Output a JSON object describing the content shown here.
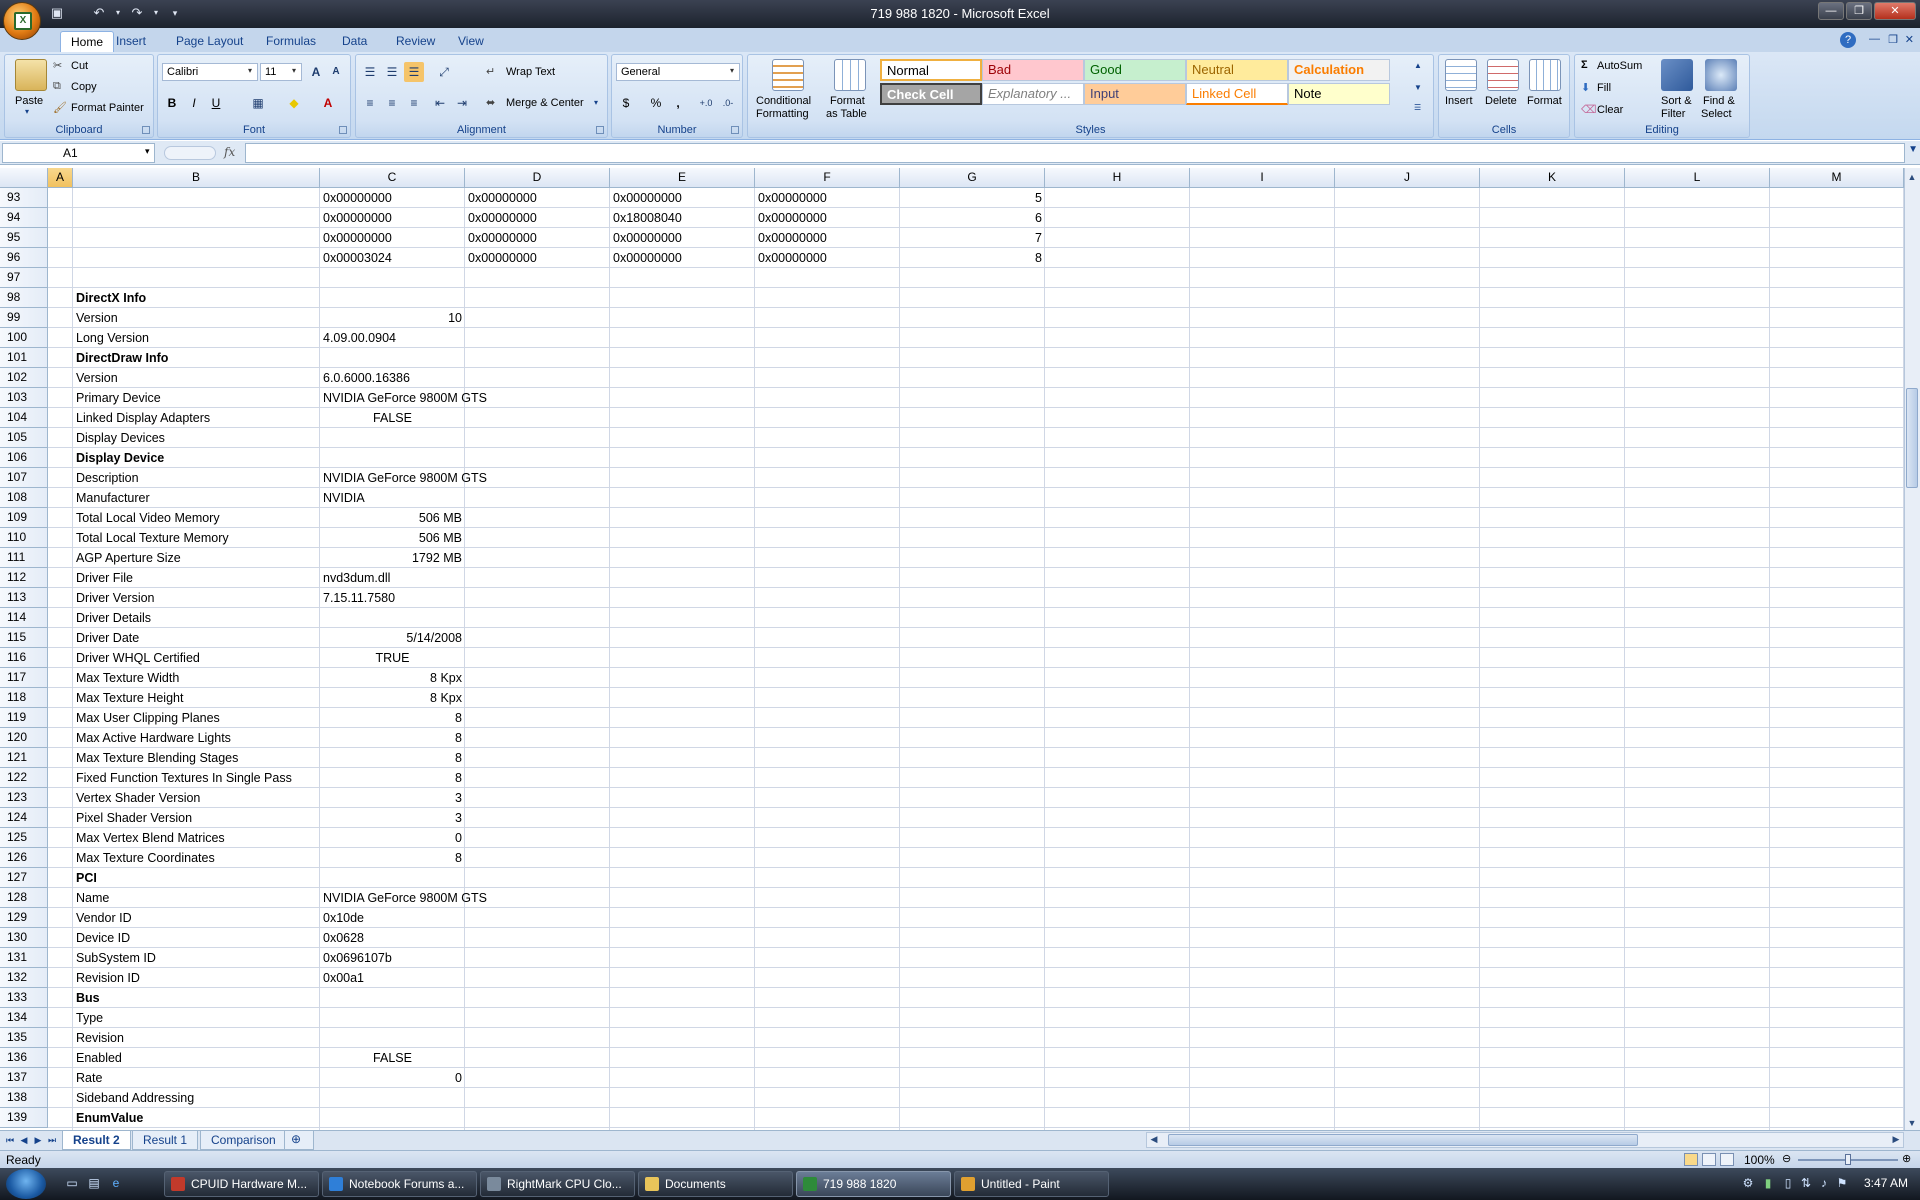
{
  "window": {
    "title": "719 988 1820 - Microsoft Excel"
  },
  "ribbon": {
    "tabs": [
      "Home",
      "Insert",
      "Page Layout",
      "Formulas",
      "Data",
      "Review",
      "View"
    ],
    "clipboard": {
      "paste": "Paste",
      "cut": "Cut",
      "copy": "Copy",
      "format_painter": "Format Painter",
      "label": "Clipboard"
    },
    "font": {
      "name": "Calibri",
      "size": "11",
      "label": "Font",
      "bold": "B",
      "italic": "I",
      "underline": "U"
    },
    "alignment": {
      "wrap_text": "Wrap Text",
      "merge_center": "Merge & Center",
      "label": "Alignment"
    },
    "number": {
      "format": "General",
      "currency": "$",
      "percent": "%",
      "comma": ",",
      "label": "Number"
    },
    "styles": {
      "conditional": "Conditional",
      "conditional2": "Formatting",
      "format_table": "Format",
      "format_table2": "as Table",
      "label": "Styles",
      "cells": [
        {
          "name": "Normal",
          "bg": "#ffffff",
          "fg": "#000000"
        },
        {
          "name": "Bad",
          "bg": "#ffc7ce",
          "fg": "#9c0006"
        },
        {
          "name": "Good",
          "bg": "#c6efce",
          "fg": "#006100"
        },
        {
          "name": "Neutral",
          "bg": "#ffeb9c",
          "fg": "#9c6500"
        },
        {
          "name": "Calculation",
          "bg": "#f2f2f2",
          "fg": "#fa7d00"
        },
        {
          "name": "Check Cell",
          "bg": "#a5a5a5",
          "fg": "#ffffff"
        },
        {
          "name": "Explanatory ...",
          "bg": "#ffffff",
          "fg": "#7f7f7f"
        },
        {
          "name": "Input",
          "bg": "#ffcc99",
          "fg": "#3f3f76"
        },
        {
          "name": "Linked Cell",
          "bg": "#ffffff",
          "fg": "#fa7d00"
        },
        {
          "name": "Note",
          "bg": "#ffffcc",
          "fg": "#000000"
        }
      ]
    },
    "cells": {
      "insert": "Insert",
      "delete": "Delete",
      "format": "Format",
      "label": "Cells"
    },
    "editing": {
      "autosum": "AutoSum",
      "fill": "Fill",
      "clear": "Clear",
      "sort": "Sort &",
      "sort2": "Filter",
      "find": "Find &",
      "find2": "Select",
      "label": "Editing"
    }
  },
  "formula_bar": {
    "name_box": "A1",
    "fx": "fx",
    "value": ""
  },
  "columns": [
    "A",
    "B",
    "C",
    "D",
    "E",
    "F",
    "G",
    "H",
    "I",
    "J",
    "K",
    "L",
    "M"
  ],
  "rows": [
    {
      "n": "93",
      "C": "0x00000000",
      "D": "0x00000000",
      "E": "0x00000000",
      "F": "0x00000000",
      "G": "5"
    },
    {
      "n": "94",
      "C": "0x00000000",
      "D": "0x00000000",
      "E": "0x18008040",
      "F": "0x00000000",
      "G": "6"
    },
    {
      "n": "95",
      "C": "0x00000000",
      "D": "0x00000000",
      "E": "0x00000000",
      "F": "0x00000000",
      "G": "7"
    },
    {
      "n": "96",
      "C": "0x00003024",
      "D": "0x00000000",
      "E": "0x00000000",
      "F": "0x00000000",
      "G": "8"
    },
    {
      "n": "97"
    },
    {
      "n": "98",
      "B": "DirectX Info",
      "bold": true
    },
    {
      "n": "99",
      "B": "Version",
      "C": "10",
      "Calign": "r"
    },
    {
      "n": "100",
      "B": "Long Version",
      "C": "4.09.00.0904"
    },
    {
      "n": "101",
      "B": "DirectDraw Info",
      "bold": true
    },
    {
      "n": "102",
      "B": "Version",
      "C": "6.0.6000.16386"
    },
    {
      "n": "103",
      "B": "Primary Device",
      "C": "NVIDIA GeForce 9800M GTS"
    },
    {
      "n": "104",
      "B": "Linked Display Adapters",
      "C": "FALSE",
      "Calign": "c"
    },
    {
      "n": "105",
      "B": "Display Devices"
    },
    {
      "n": "106",
      "B": "Display Device",
      "bold": true
    },
    {
      "n": "107",
      "B": "Description",
      "C": "NVIDIA GeForce 9800M GTS"
    },
    {
      "n": "108",
      "B": "Manufacturer",
      "C": "NVIDIA"
    },
    {
      "n": "109",
      "B": "Total Local Video Memory",
      "C": "506 MB",
      "Calign": "r"
    },
    {
      "n": "110",
      "B": "Total Local Texture Memory",
      "C": "506 MB",
      "Calign": "r"
    },
    {
      "n": "111",
      "B": "AGP Aperture Size",
      "C": "1792 MB",
      "Calign": "r"
    },
    {
      "n": "112",
      "B": "Driver File",
      "C": "nvd3dum.dll"
    },
    {
      "n": "113",
      "B": "Driver Version",
      "C": "7.15.11.7580"
    },
    {
      "n": "114",
      "B": "Driver Details"
    },
    {
      "n": "115",
      "B": "Driver Date",
      "C": "5/14/2008",
      "Calign": "r"
    },
    {
      "n": "116",
      "B": "Driver WHQL Certified",
      "C": "TRUE",
      "Calign": "c"
    },
    {
      "n": "117",
      "B": "Max Texture Width",
      "C": "8 Kpx",
      "Calign": "r"
    },
    {
      "n": "118",
      "B": "Max Texture Height",
      "C": "8 Kpx",
      "Calign": "r"
    },
    {
      "n": "119",
      "B": "Max User Clipping Planes",
      "C": "8",
      "Calign": "r"
    },
    {
      "n": "120",
      "B": "Max Active Hardware Lights",
      "C": "8",
      "Calign": "r"
    },
    {
      "n": "121",
      "B": "Max Texture Blending Stages",
      "C": "8",
      "Calign": "r"
    },
    {
      "n": "122",
      "B": "Fixed Function Textures In Single Pass",
      "C": "8",
      "Calign": "r"
    },
    {
      "n": "123",
      "B": "Vertex Shader Version",
      "C": "3",
      "Calign": "r"
    },
    {
      "n": "124",
      "B": "Pixel Shader Version",
      "C": "3",
      "Calign": "r"
    },
    {
      "n": "125",
      "B": "Max Vertex Blend Matrices",
      "C": "0",
      "Calign": "r"
    },
    {
      "n": "126",
      "B": "Max Texture Coordinates",
      "C": "8",
      "Calign": "r"
    },
    {
      "n": "127",
      "B": "PCI",
      "bold": true
    },
    {
      "n": "128",
      "B": "Name",
      "C": "NVIDIA GeForce 9800M GTS"
    },
    {
      "n": "129",
      "B": "Vendor ID",
      "C": "0x10de"
    },
    {
      "n": "130",
      "B": "Device ID",
      "C": "0x0628"
    },
    {
      "n": "131",
      "B": "SubSystem ID",
      "C": "0x0696107b"
    },
    {
      "n": "132",
      "B": "Revision ID",
      "C": "0x00a1"
    },
    {
      "n": "133",
      "B": "Bus",
      "bold": true
    },
    {
      "n": "134",
      "B": "Type"
    },
    {
      "n": "135",
      "B": "Revision"
    },
    {
      "n": "136",
      "B": "Enabled",
      "C": "FALSE",
      "Calign": "c"
    },
    {
      "n": "137",
      "B": "Rate",
      "C": "0",
      "Calign": "r"
    },
    {
      "n": "138",
      "B": "Sideband Addressing"
    },
    {
      "n": "139",
      "B": "EnumValue",
      "bold": true
    }
  ],
  "sheets": [
    "Result 2",
    "Result 1",
    "Comparison"
  ],
  "active_sheet": "Result 2",
  "status": {
    "ready": "Ready",
    "zoom": "100%"
  },
  "taskbar": {
    "buttons": [
      {
        "label": "CPUID Hardware M...",
        "color": "#c23a2b"
      },
      {
        "label": "Notebook Forums a...",
        "color": "#2f7fd8"
      },
      {
        "label": "RightMark CPU Clo...",
        "color": "#7a8a9c"
      },
      {
        "label": "Documents",
        "color": "#e8c45a"
      },
      {
        "label": "719 988 1820",
        "color": "#2e8b3a"
      },
      {
        "label": "Untitled - Paint",
        "color": "#e0a030"
      }
    ],
    "clock": "3:47 AM"
  }
}
